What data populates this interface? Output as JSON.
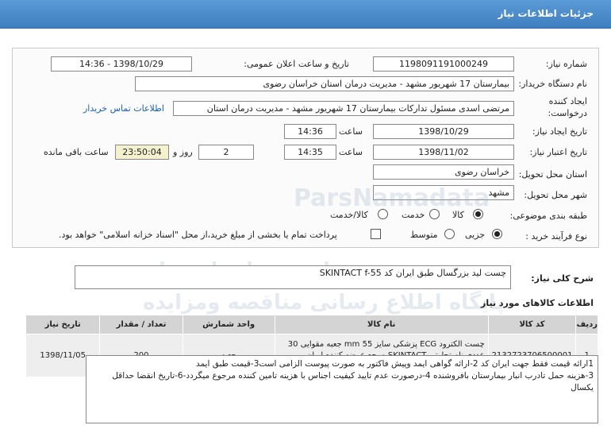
{
  "header": {
    "title": "جزئیات اطلاعات نیاز"
  },
  "form": {
    "need_number_label": "شماره نیاز:",
    "need_number": "1198091191000249",
    "announce_label": "تاریخ و ساعت اعلان عمومی:",
    "announce_value": "1398/10/29 - 14:36",
    "buyer_label": "نام دستگاه خریدار:",
    "buyer_value": "بیمارستان 17 شهریور مشهد - مدیریت درمان استان خراسان رضوی",
    "creator_label_1": "ایجاد کننده",
    "creator_label_2": "درخواست:",
    "creator_value": "مرتضی اسدی مسئول تدارکات بیمارستان 17 شهریور مشهد - مدیریت درمان استان",
    "contact_link": "اطلاعات تماس خریدار",
    "create_date_label": "تاریخ ایجاد نیاز:",
    "create_date": "1398/10/29",
    "time_label": "ساعت",
    "create_time": "14:36",
    "validity_label": "تاریخ اعتبار نیاز:",
    "validity_date": "1398/11/02",
    "validity_time": "14:35",
    "days": "2",
    "day_and_label": "روز و",
    "remaining_time": "23:50:04",
    "remaining_label": "ساعت باقی مانده",
    "province_label": "استان محل تحویل:",
    "province_value": "خراسان رضوی",
    "city_label": "شهر محل تحویل:",
    "city_value": "مشهد",
    "category_label": "طبقه بندی موضوعی:",
    "category_options": [
      "کالا",
      "خدمت",
      "کالا/خدمت"
    ],
    "process_label": "نوع فرآیند خرید :",
    "process_options": [
      "جزیی",
      "متوسط"
    ],
    "payment_text": "پرداخت تمام یا بخشی از مبلغ خرید،از محل \"اسناد خزانه اسلامی\" خواهد بود."
  },
  "description": {
    "label": "شرح کلی نیاز:",
    "value": "چست لید بزرگسال   طبق ایران کد SKINTACT f-55"
  },
  "items_section": {
    "title": "اطلاعات کالاهای مورد نیاز",
    "headers": [
      "ردیف",
      "کد کالا",
      "نام کالا",
      "واحد شمارش",
      "تعداد / مقدار",
      "تاریخ نیاز"
    ],
    "rows": [
      {
        "index": "1",
        "code": "2132723706500001",
        "name": "چست الکترود ECG پزشکی سایز mm 55 جعبه مقوایی 30 عددی نام تجارتی SKINTACT مرجع عرضه کننده ایران فارمیس",
        "unit": "جعبه",
        "qty": "200",
        "date": "1398/11/05"
      }
    ]
  },
  "notes": {
    "line1": "1ارائه قیمت فقط جهت ایران کد 2-ارائه گواهی ایمد وپیش فاکتور به صورت پیوست الزامی است3-قیمت طبق ایمد",
    "line2": "3-هزینه حمل تادرب انبار بیمارستان بافروشنده 4-درصورت عدم تایید کیفیت  اجناس با هزینه تامین کننده مرجوع میگردد-6-تاریخ انقضا حداقل یکسال"
  },
  "watermark": {
    "line1": "ParsNamadata",
    "line2": "پارس نماد داده ها",
    "line3": "پایگاه اطلاع رسانی مناقصه ومزایده"
  },
  "colors": {
    "header": "#4a8bcb",
    "link": "#1a5fb4",
    "highlight": "#f4f1cf"
  }
}
